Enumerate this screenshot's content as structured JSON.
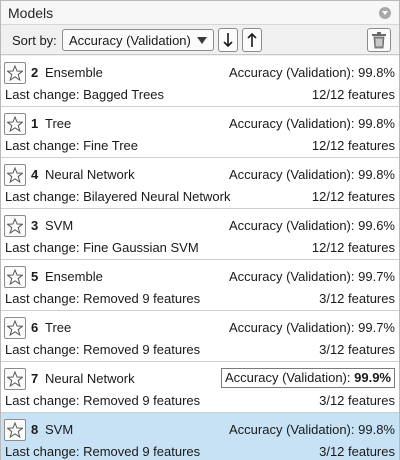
{
  "panel": {
    "title": "Models",
    "collapse_icon": "collapse-arrow-icon"
  },
  "toolbar": {
    "sort_label": "Sort by:",
    "sort_selected": "Accuracy (Validation)",
    "sort_ascending_icon": "sort-down-arrow-icon",
    "sort_descending_icon": "sort-up-arrow-icon",
    "delete_icon": "trash-icon"
  },
  "models": [
    {
      "num": "2",
      "type": "Ensemble",
      "metric_label": "Accuracy (Validation):",
      "metric_value": "99.8%",
      "last_change_label": "Last change:",
      "last_change": "Bagged Trees",
      "features": "12/12 features"
    },
    {
      "num": "1",
      "type": "Tree",
      "metric_label": "Accuracy (Validation):",
      "metric_value": "99.8%",
      "last_change_label": "Last change:",
      "last_change": "Fine Tree",
      "features": "12/12 features"
    },
    {
      "num": "4",
      "type": "Neural Network",
      "metric_label": "Accuracy (Validation):",
      "metric_value": "99.8%",
      "last_change_label": "Last change:",
      "last_change": "Bilayered Neural Network",
      "features": "12/12 features"
    },
    {
      "num": "3",
      "type": "SVM",
      "metric_label": "Accuracy (Validation):",
      "metric_value": "99.6%",
      "last_change_label": "Last change:",
      "last_change": "Fine Gaussian SVM",
      "features": "12/12 features"
    },
    {
      "num": "5",
      "type": "Ensemble",
      "metric_label": "Accuracy (Validation):",
      "metric_value": "99.7%",
      "last_change_label": "Last change:",
      "last_change": "Removed 9 features",
      "features": "3/12 features"
    },
    {
      "num": "6",
      "type": "Tree",
      "metric_label": "Accuracy (Validation):",
      "metric_value": "99.7%",
      "last_change_label": "Last change:",
      "last_change": "Removed 9 features",
      "features": "3/12 features"
    },
    {
      "num": "7",
      "type": "Neural Network",
      "metric_label": "Accuracy (Validation):",
      "metric_value": "99.9%",
      "last_change_label": "Last change:",
      "last_change": "Removed 9 features",
      "features": "3/12 features",
      "best": true
    },
    {
      "num": "8",
      "type": "SVM",
      "metric_label": "Accuracy (Validation):",
      "metric_value": "99.8%",
      "last_change_label": "Last change:",
      "last_change": "Removed 9 features",
      "features": "3/12 features",
      "selected": true
    }
  ],
  "colors": {
    "selected_row": "#c7e1f5",
    "row": "#ffffff",
    "toolbar": "#f0f0f0"
  }
}
